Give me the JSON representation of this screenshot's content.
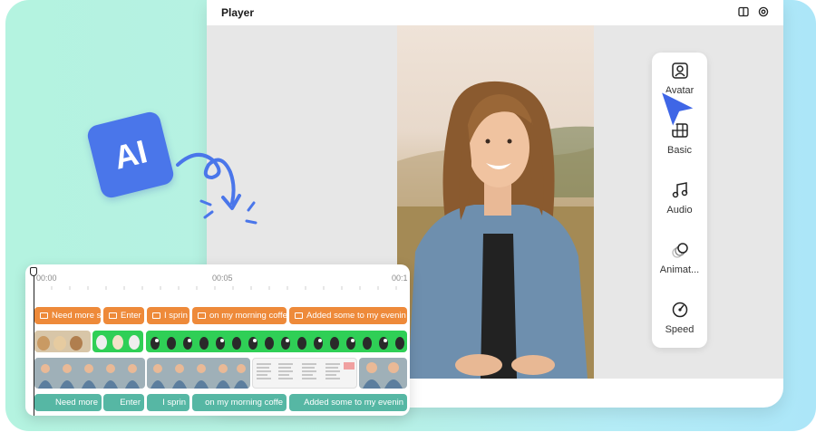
{
  "player": {
    "title": "Player",
    "icons": [
      "split-view-icon",
      "settings-icon"
    ]
  },
  "tools": [
    {
      "label": "Avatar",
      "icon": "avatar-icon"
    },
    {
      "label": "Basic",
      "icon": "film-icon"
    },
    {
      "label": "Audio",
      "icon": "music-note-icon"
    },
    {
      "label": "Animat...",
      "icon": "animation-icon"
    },
    {
      "label": "Speed",
      "icon": "speed-gauge-icon"
    }
  ],
  "badge": {
    "text": "AI"
  },
  "timeline": {
    "ticks": [
      "00:00",
      "00:05",
      "00:1"
    ],
    "captions": [
      "Need more s",
      "Enter",
      "I sprin",
      "on my morning coffe",
      "Added some to my evenin"
    ],
    "audio": [
      "Need more",
      "Enter",
      "I sprin",
      "on my morning coffe",
      "Added some to my evenin"
    ]
  },
  "colors": {
    "accent": "#4a76ea",
    "caption": "#ee8a3a",
    "green_screen": "#2fcf56",
    "audio": "#56b7a4"
  }
}
